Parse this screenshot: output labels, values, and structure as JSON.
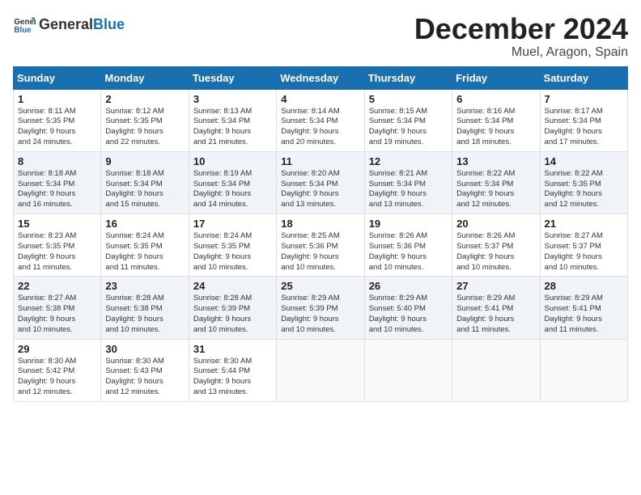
{
  "header": {
    "logo_general": "General",
    "logo_blue": "Blue",
    "month_title": "December 2024",
    "location": "Muel, Aragon, Spain"
  },
  "weekdays": [
    "Sunday",
    "Monday",
    "Tuesday",
    "Wednesday",
    "Thursday",
    "Friday",
    "Saturday"
  ],
  "weeks": [
    [
      {
        "day": "1",
        "lines": [
          "Sunrise: 8:11 AM",
          "Sunset: 5:35 PM",
          "Daylight: 9 hours",
          "and 24 minutes."
        ]
      },
      {
        "day": "2",
        "lines": [
          "Sunrise: 8:12 AM",
          "Sunset: 5:35 PM",
          "Daylight: 9 hours",
          "and 22 minutes."
        ]
      },
      {
        "day": "3",
        "lines": [
          "Sunrise: 8:13 AM",
          "Sunset: 5:34 PM",
          "Daylight: 9 hours",
          "and 21 minutes."
        ]
      },
      {
        "day": "4",
        "lines": [
          "Sunrise: 8:14 AM",
          "Sunset: 5:34 PM",
          "Daylight: 9 hours",
          "and 20 minutes."
        ]
      },
      {
        "day": "5",
        "lines": [
          "Sunrise: 8:15 AM",
          "Sunset: 5:34 PM",
          "Daylight: 9 hours",
          "and 19 minutes."
        ]
      },
      {
        "day": "6",
        "lines": [
          "Sunrise: 8:16 AM",
          "Sunset: 5:34 PM",
          "Daylight: 9 hours",
          "and 18 minutes."
        ]
      },
      {
        "day": "7",
        "lines": [
          "Sunrise: 8:17 AM",
          "Sunset: 5:34 PM",
          "Daylight: 9 hours",
          "and 17 minutes."
        ]
      }
    ],
    [
      {
        "day": "8",
        "lines": [
          "Sunrise: 8:18 AM",
          "Sunset: 5:34 PM",
          "Daylight: 9 hours",
          "and 16 minutes."
        ]
      },
      {
        "day": "9",
        "lines": [
          "Sunrise: 8:18 AM",
          "Sunset: 5:34 PM",
          "Daylight: 9 hours",
          "and 15 minutes."
        ]
      },
      {
        "day": "10",
        "lines": [
          "Sunrise: 8:19 AM",
          "Sunset: 5:34 PM",
          "Daylight: 9 hours",
          "and 14 minutes."
        ]
      },
      {
        "day": "11",
        "lines": [
          "Sunrise: 8:20 AM",
          "Sunset: 5:34 PM",
          "Daylight: 9 hours",
          "and 13 minutes."
        ]
      },
      {
        "day": "12",
        "lines": [
          "Sunrise: 8:21 AM",
          "Sunset: 5:34 PM",
          "Daylight: 9 hours",
          "and 13 minutes."
        ]
      },
      {
        "day": "13",
        "lines": [
          "Sunrise: 8:22 AM",
          "Sunset: 5:34 PM",
          "Daylight: 9 hours",
          "and 12 minutes."
        ]
      },
      {
        "day": "14",
        "lines": [
          "Sunrise: 8:22 AM",
          "Sunset: 5:35 PM",
          "Daylight: 9 hours",
          "and 12 minutes."
        ]
      }
    ],
    [
      {
        "day": "15",
        "lines": [
          "Sunrise: 8:23 AM",
          "Sunset: 5:35 PM",
          "Daylight: 9 hours",
          "and 11 minutes."
        ]
      },
      {
        "day": "16",
        "lines": [
          "Sunrise: 8:24 AM",
          "Sunset: 5:35 PM",
          "Daylight: 9 hours",
          "and 11 minutes."
        ]
      },
      {
        "day": "17",
        "lines": [
          "Sunrise: 8:24 AM",
          "Sunset: 5:35 PM",
          "Daylight: 9 hours",
          "and 10 minutes."
        ]
      },
      {
        "day": "18",
        "lines": [
          "Sunrise: 8:25 AM",
          "Sunset: 5:36 PM",
          "Daylight: 9 hours",
          "and 10 minutes."
        ]
      },
      {
        "day": "19",
        "lines": [
          "Sunrise: 8:26 AM",
          "Sunset: 5:36 PM",
          "Daylight: 9 hours",
          "and 10 minutes."
        ]
      },
      {
        "day": "20",
        "lines": [
          "Sunrise: 8:26 AM",
          "Sunset: 5:37 PM",
          "Daylight: 9 hours",
          "and 10 minutes."
        ]
      },
      {
        "day": "21",
        "lines": [
          "Sunrise: 8:27 AM",
          "Sunset: 5:37 PM",
          "Daylight: 9 hours",
          "and 10 minutes."
        ]
      }
    ],
    [
      {
        "day": "22",
        "lines": [
          "Sunrise: 8:27 AM",
          "Sunset: 5:38 PM",
          "Daylight: 9 hours",
          "and 10 minutes."
        ]
      },
      {
        "day": "23",
        "lines": [
          "Sunrise: 8:28 AM",
          "Sunset: 5:38 PM",
          "Daylight: 9 hours",
          "and 10 minutes."
        ]
      },
      {
        "day": "24",
        "lines": [
          "Sunrise: 8:28 AM",
          "Sunset: 5:39 PM",
          "Daylight: 9 hours",
          "and 10 minutes."
        ]
      },
      {
        "day": "25",
        "lines": [
          "Sunrise: 8:29 AM",
          "Sunset: 5:39 PM",
          "Daylight: 9 hours",
          "and 10 minutes."
        ]
      },
      {
        "day": "26",
        "lines": [
          "Sunrise: 8:29 AM",
          "Sunset: 5:40 PM",
          "Daylight: 9 hours",
          "and 10 minutes."
        ]
      },
      {
        "day": "27",
        "lines": [
          "Sunrise: 8:29 AM",
          "Sunset: 5:41 PM",
          "Daylight: 9 hours",
          "and 11 minutes."
        ]
      },
      {
        "day": "28",
        "lines": [
          "Sunrise: 8:29 AM",
          "Sunset: 5:41 PM",
          "Daylight: 9 hours",
          "and 11 minutes."
        ]
      }
    ],
    [
      {
        "day": "29",
        "lines": [
          "Sunrise: 8:30 AM",
          "Sunset: 5:42 PM",
          "Daylight: 9 hours",
          "and 12 minutes."
        ]
      },
      {
        "day": "30",
        "lines": [
          "Sunrise: 8:30 AM",
          "Sunset: 5:43 PM",
          "Daylight: 9 hours",
          "and 12 minutes."
        ]
      },
      {
        "day": "31",
        "lines": [
          "Sunrise: 8:30 AM",
          "Sunset: 5:44 PM",
          "Daylight: 9 hours",
          "and 13 minutes."
        ]
      },
      {
        "day": "",
        "lines": []
      },
      {
        "day": "",
        "lines": []
      },
      {
        "day": "",
        "lines": []
      },
      {
        "day": "",
        "lines": []
      }
    ]
  ]
}
